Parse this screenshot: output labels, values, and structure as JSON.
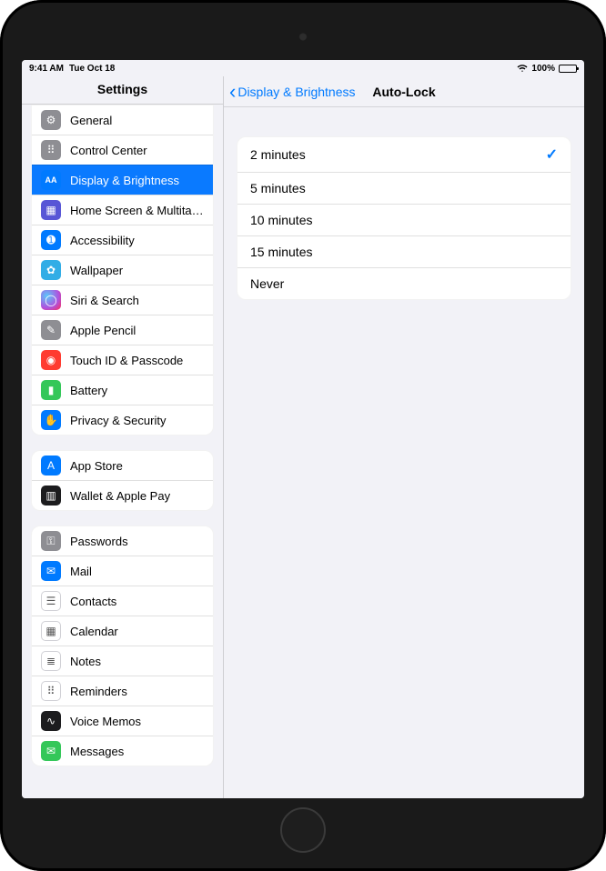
{
  "status": {
    "time": "9:41 AM",
    "date": "Tue Oct 18",
    "battery_pct": "100%"
  },
  "sidebar": {
    "title": "Settings",
    "groups": [
      [
        {
          "id": "general",
          "label": "General",
          "icon": "gear-icon",
          "bg": "i-gray"
        },
        {
          "id": "control-center",
          "label": "Control Center",
          "icon": "sliders-icon",
          "bg": "i-gray"
        },
        {
          "id": "display-brightness",
          "label": "Display & Brightness",
          "icon": "text-size-icon",
          "bg": "i-blue",
          "selected": true
        },
        {
          "id": "home-screen",
          "label": "Home Screen & Multitas…",
          "icon": "grid-icon",
          "bg": "i-indigo"
        },
        {
          "id": "accessibility",
          "label": "Accessibility",
          "icon": "accessibility-icon",
          "bg": "i-blue"
        },
        {
          "id": "wallpaper",
          "label": "Wallpaper",
          "icon": "flower-icon",
          "bg": "i-cyan"
        },
        {
          "id": "siri-search",
          "label": "Siri & Search",
          "icon": "siri-icon",
          "bg": "i-siri"
        },
        {
          "id": "apple-pencil",
          "label": "Apple Pencil",
          "icon": "pencil-icon",
          "bg": "i-gray"
        },
        {
          "id": "touch-id",
          "label": "Touch ID & Passcode",
          "icon": "fingerprint-icon",
          "bg": "i-red"
        },
        {
          "id": "battery",
          "label": "Battery",
          "icon": "battery-icon",
          "bg": "i-green"
        },
        {
          "id": "privacy",
          "label": "Privacy & Security",
          "icon": "hand-icon",
          "bg": "i-blue"
        }
      ],
      [
        {
          "id": "app-store",
          "label": "App Store",
          "icon": "appstore-icon",
          "bg": "i-blue"
        },
        {
          "id": "wallet",
          "label": "Wallet & Apple Pay",
          "icon": "wallet-icon",
          "bg": "i-black"
        }
      ],
      [
        {
          "id": "passwords",
          "label": "Passwords",
          "icon": "key-icon",
          "bg": "i-gray"
        },
        {
          "id": "mail",
          "label": "Mail",
          "icon": "mail-icon",
          "bg": "i-blue"
        },
        {
          "id": "contacts",
          "label": "Contacts",
          "icon": "contacts-icon",
          "bg": "i-white"
        },
        {
          "id": "calendar",
          "label": "Calendar",
          "icon": "calendar-icon",
          "bg": "i-white"
        },
        {
          "id": "notes",
          "label": "Notes",
          "icon": "notes-icon",
          "bg": "i-white"
        },
        {
          "id": "reminders",
          "label": "Reminders",
          "icon": "reminders-icon",
          "bg": "i-white"
        },
        {
          "id": "voice-memos",
          "label": "Voice Memos",
          "icon": "voicememos-icon",
          "bg": "i-black"
        },
        {
          "id": "messages",
          "label": "Messages",
          "icon": "messages-icon",
          "bg": "i-green"
        }
      ]
    ]
  },
  "detail": {
    "back_label": "Display & Brightness",
    "title": "Auto-Lock",
    "options": [
      {
        "label": "2 minutes",
        "selected": true
      },
      {
        "label": "5 minutes",
        "selected": false
      },
      {
        "label": "10 minutes",
        "selected": false
      },
      {
        "label": "15 minutes",
        "selected": false
      },
      {
        "label": "Never",
        "selected": false
      }
    ]
  }
}
